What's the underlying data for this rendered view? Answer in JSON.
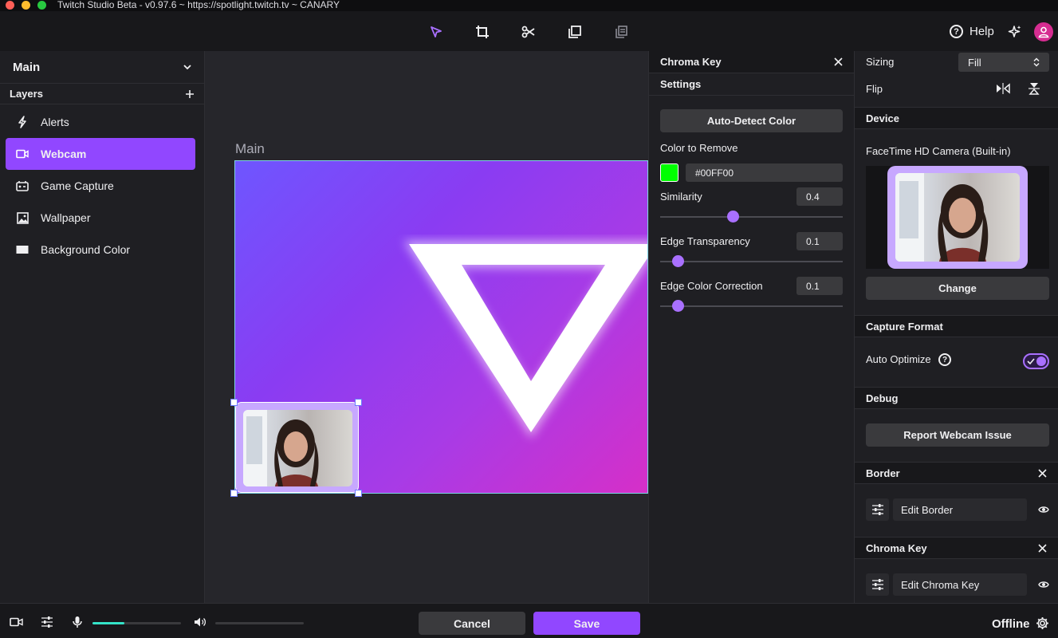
{
  "window": {
    "title": "Twitch Studio Beta - v0.97.6 ~ https://spotlight.twitch.tv ~ CANARY"
  },
  "toolbar": {
    "tools": [
      "select-arrow-icon",
      "crop-icon",
      "scissors-icon",
      "duplicate-icon",
      "layers-stack-icon"
    ],
    "help_label": "Help"
  },
  "sidebar": {
    "scene": "Main",
    "layers_title": "Layers",
    "layers": [
      {
        "label": "Alerts",
        "icon": "lightning-icon",
        "active": false
      },
      {
        "label": "Webcam",
        "icon": "video-camera-icon",
        "active": true
      },
      {
        "label": "Game Capture",
        "icon": "game-controller-icon",
        "active": false
      },
      {
        "label": "Wallpaper",
        "icon": "image-icon",
        "active": false
      },
      {
        "label": "Background Color",
        "icon": "color-rectangle-icon",
        "active": false
      }
    ]
  },
  "canvas": {
    "scene_label": "Main"
  },
  "chroma_key_panel": {
    "title": "Chroma Key",
    "settings_title": "Settings",
    "auto_detect_label": "Auto-Detect Color",
    "color_to_remove_label": "Color to Remove",
    "color_value": "#00FF00",
    "swatch_color": "#00ff00",
    "similarity": {
      "label": "Similarity",
      "value": "0.4",
      "fraction": 0.4
    },
    "edge_transparency": {
      "label": "Edge Transparency",
      "value": "0.1",
      "fraction": 0.1
    },
    "edge_color_correction": {
      "label": "Edge Color Correction",
      "value": "0.1",
      "fraction": 0.1
    }
  },
  "properties": {
    "sizing_label": "Sizing",
    "sizing_value": "Fill",
    "flip_label": "Flip",
    "device_title": "Device",
    "device_name": "FaceTime HD Camera (Built-in)",
    "change_label": "Change",
    "capture_format_title": "Capture Format",
    "auto_optimize_label": "Auto Optimize",
    "auto_optimize_on": true,
    "debug_title": "Debug",
    "report_label": "Report Webcam Issue",
    "border_title": "Border",
    "edit_border_label": "Edit Border",
    "chroma_title": "Chroma Key",
    "edit_chroma_label": "Edit Chroma Key"
  },
  "bottom": {
    "mic_level": 0.36,
    "cancel_label": "Cancel",
    "save_label": "Save",
    "status": "Offline"
  },
  "colors": {
    "accent": "#9147ff",
    "background": "#18181b",
    "panel": "#1f1f23",
    "volume": "#34e3c8"
  }
}
